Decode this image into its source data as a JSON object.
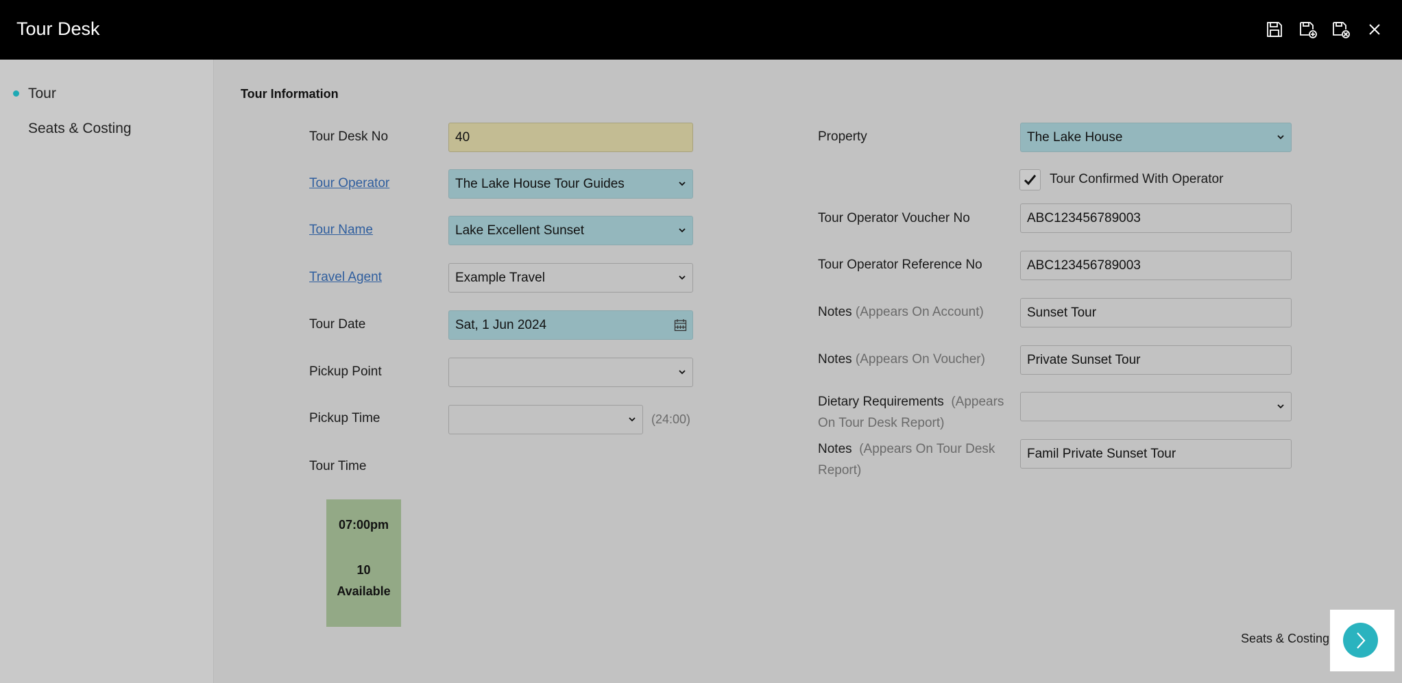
{
  "header": {
    "title": "Tour Desk",
    "icons": [
      "save-icon",
      "save-and-add-icon",
      "save-and-close-icon",
      "close-icon"
    ]
  },
  "sidebar": {
    "items": [
      {
        "label": "Tour",
        "active": true
      },
      {
        "label": "Seats & Costing",
        "active": false
      }
    ],
    "accent_color": "#1ea9b4"
  },
  "section": {
    "title": "Tour Information"
  },
  "left": {
    "tour_desk_no": {
      "label": "Tour Desk No",
      "value": "40"
    },
    "tour_operator": {
      "label": "Tour Operator",
      "value": "The Lake House Tour Guides"
    },
    "tour_name": {
      "label": "Tour Name",
      "value": "Lake Excellent Sunset"
    },
    "travel_agent": {
      "label": "Travel Agent",
      "value": "Example Travel"
    },
    "tour_date": {
      "label": "Tour Date",
      "value": "Sat, 1 Jun 2024"
    },
    "pickup_point": {
      "label": "Pickup Point",
      "value": ""
    },
    "pickup_time": {
      "label": "Pickup Time",
      "value": "",
      "hint": "(24:00)"
    },
    "tour_time": {
      "label": "Tour Time"
    }
  },
  "tour_slot": {
    "time": "07:00pm",
    "count": "10",
    "status": "Available"
  },
  "right": {
    "property": {
      "label": "Property",
      "value": "The Lake House"
    },
    "confirmed": {
      "label": "Tour Confirmed With Operator",
      "checked": true
    },
    "voucher_no": {
      "label": "Tour Operator Voucher No",
      "value": "ABC123456789003"
    },
    "reference_no": {
      "label": "Tour Operator Reference No",
      "value": "ABC123456789003"
    },
    "notes_account": {
      "label": "Notes",
      "hint": "(Appears On Account)",
      "value": "Sunset Tour"
    },
    "notes_voucher": {
      "label": "Notes",
      "hint": "(Appears On Voucher)",
      "value": "Private Sunset Tour"
    },
    "dietary": {
      "label": "Dietary Requirements",
      "hint": "(Appears On Tour Desk Report)",
      "value": ""
    },
    "notes_report": {
      "label": "Notes",
      "hint": "(Appears On Tour Desk Report)",
      "value": "Famil Private Sunset Tour"
    }
  },
  "footer": {
    "next_label": "Seats & Costing"
  },
  "colors": {
    "header_bg": "#000000",
    "page_bg": "#c2c2c2",
    "required_field": "#94b7bd",
    "readonly_field": "#c3bc93",
    "tour_slot": "#93a986",
    "link": "#2f5e9e",
    "next_button": "#2ab3bf"
  }
}
